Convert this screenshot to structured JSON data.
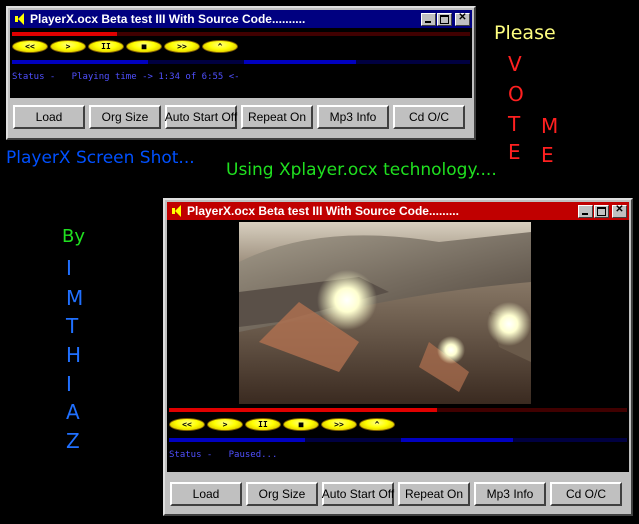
{
  "window1": {
    "title": "PlayerX.ocx Beta test III With Source Code..........",
    "status_label": "Status -",
    "status_text": "Playing time -> 1:34 of 6:55 <-",
    "buttons": [
      "Load",
      "Org Size",
      "Auto Start Off",
      "Repeat On",
      "Mp3 Info",
      "Cd O/C"
    ],
    "transport": [
      "<<",
      ">",
      "II",
      "■",
      ">>",
      "^"
    ]
  },
  "window2": {
    "title": "PlayerX.ocx Beta test III With Source Code.........",
    "status_label": "Status -",
    "status_text": "Paused...",
    "buttons": [
      "Load",
      "Org Size",
      "Auto Start Off",
      "Repeat On",
      "Mp3 Info",
      "Cd O/C"
    ],
    "transport": [
      "<<",
      ">",
      "II",
      "■",
      ">>",
      "^"
    ]
  },
  "captions": {
    "screenshot": "PlayerX Screen Shot...",
    "technology": "Using Xplayer.ocx technology....",
    "please": "Please",
    "vote": [
      "V",
      "O",
      "T",
      "E"
    ],
    "me": [
      "M",
      "E"
    ],
    "by": "By",
    "name": [
      "I",
      "M",
      "T",
      "H",
      "I",
      "A",
      "Z"
    ]
  },
  "colors": {
    "progress_red": "#e00000",
    "progress_blue": "#0000c0",
    "title_active": "#000080",
    "title_inactive": "#c00000"
  }
}
